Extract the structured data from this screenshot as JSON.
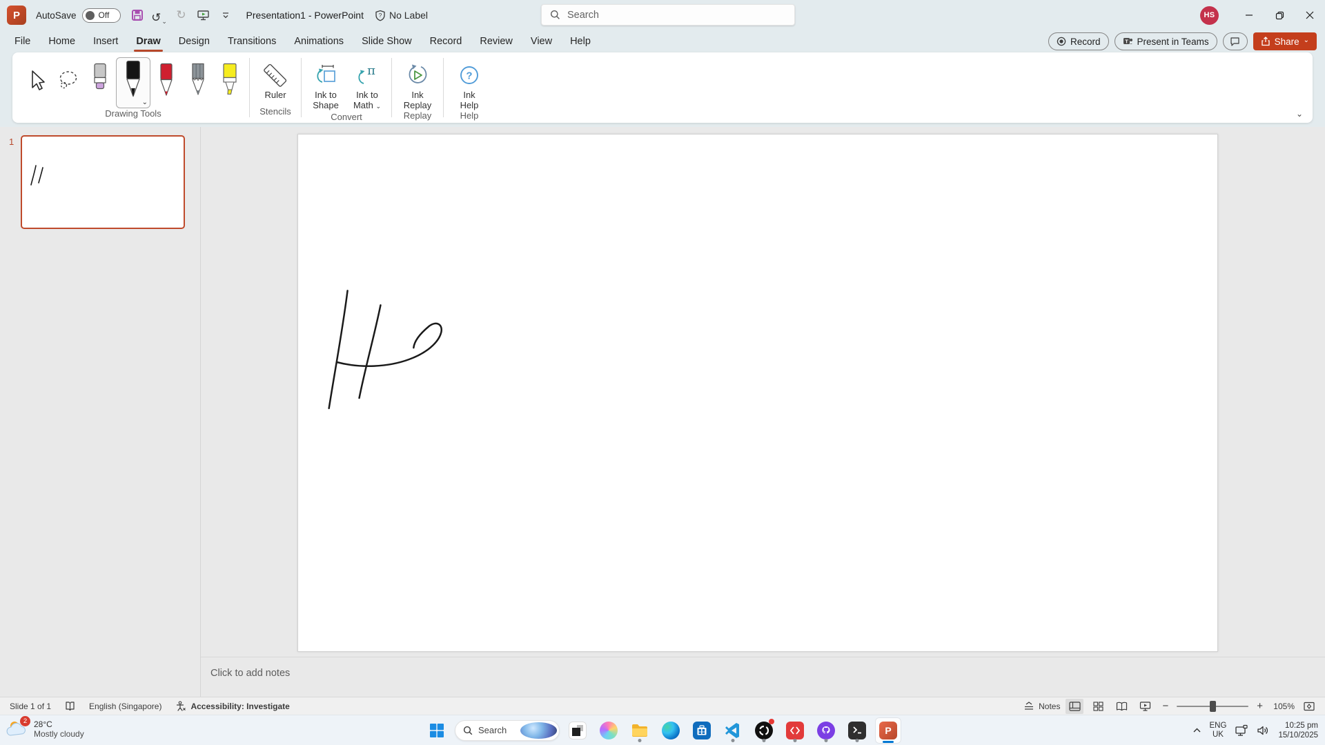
{
  "titlebar": {
    "autosave_label": "AutoSave",
    "autosave_state": "Off",
    "document_title": "Presentation1 - PowerPoint",
    "sensitivity_label": "No Label",
    "search_placeholder": "Search",
    "user_initials": "HS"
  },
  "tabs": {
    "items": [
      "File",
      "Home",
      "Insert",
      "Draw",
      "Design",
      "Transitions",
      "Animations",
      "Slide Show",
      "Record",
      "Review",
      "View",
      "Help"
    ],
    "active": "Draw"
  },
  "ribbon_actions": {
    "record": "Record",
    "present_in_teams": "Present in Teams",
    "share": "Share"
  },
  "ribbon": {
    "group_labels": {
      "drawing_tools": "Drawing Tools",
      "stencils": "Stencils",
      "convert": "Convert",
      "replay": "Replay",
      "help": "Help"
    },
    "buttons": {
      "ruler": "Ruler",
      "ink_to_shape": "Ink to Shape",
      "ink_to_math": "Ink to Math",
      "ink_replay": "Ink Replay",
      "ink_help": "Ink Help"
    }
  },
  "slide_panel": {
    "slide_number": "1"
  },
  "notes": {
    "placeholder": "Click to add notes"
  },
  "statusbar": {
    "slide_indicator": "Slide 1 of 1",
    "language": "English (Singapore)",
    "accessibility": "Accessibility: Investigate",
    "notes_toggle": "Notes",
    "zoom_level": "105%"
  },
  "taskbar": {
    "weather_badge": "2",
    "weather_temperature": "28°C",
    "weather_condition": "Mostly cloudy",
    "search_placeholder": "Search",
    "language_primary": "ENG",
    "language_region": "UK",
    "time": "10:25 pm",
    "date": "15/10/2025"
  },
  "icons": {
    "undo": "↺",
    "redo": "↻",
    "chevron_down": "⌄",
    "powerpoint_letter": "P"
  },
  "colors": {
    "accent": "#C43E1C",
    "avatar": "#C4314B",
    "selection_border": "#BF4A2B",
    "taskbar_accent": "#0078D4",
    "ink": "#1A1A1A"
  }
}
